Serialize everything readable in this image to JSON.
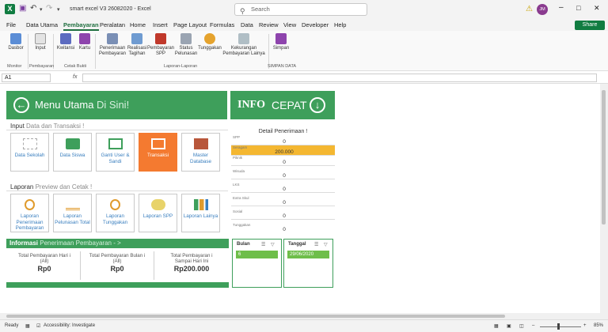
{
  "titlebar": {
    "title": "smart excel V3 26082020 - Excel",
    "search_placeholder": "Search",
    "avatar": "JM"
  },
  "menu": [
    "File",
    "Data Utama",
    "Pembayaran",
    "Peralatan",
    "Home",
    "Insert",
    "Page Layout",
    "Formulas",
    "Data",
    "Review",
    "View",
    "Developer",
    "Help"
  ],
  "share_label": "Share",
  "ribbon": {
    "buttons": [
      "Dasbor",
      "Input",
      "Kwitansi",
      "Kartu",
      "Penerimaan Pembayaran",
      "Realisasi Tagihan",
      "Pembayaran SPP",
      "Status Pelunasan",
      "Tunggakan",
      "Kekurangan Pembayaran Lainya",
      "Simpan"
    ],
    "groups": [
      "Monitor",
      "Pembayaran",
      "Cetak Bukti",
      "Laporan-Laporan",
      "SIMPAN DATA"
    ]
  },
  "formula": {
    "namebox": "A1",
    "fx": "fx"
  },
  "dashboard": {
    "menu_title_main": "Menu Utama",
    "menu_title_light": "Di Sini!",
    "input_head_main": "Input",
    "input_head_light": "Data dan Transaksi !",
    "input_tiles": [
      "Data Sekolah",
      "Data Siswa",
      "Ganti User & Sandi",
      "Transaksi",
      "Master Database"
    ],
    "laporan_head_main": "Laporan",
    "laporan_head_light": "Preview dan Cetak !",
    "laporan_tiles": [
      "Laporan Penerimaan Pembayaran",
      "Laporan Pelunasan Total",
      "Laporan Tunggakan",
      "Laporan SPP",
      "Laporan Lainya"
    ],
    "info_head_main": "Informasi",
    "info_head_light": "Penerimaan Pembayaran - >",
    "info_cells": [
      {
        "label": "Total Pembayaran Hari i",
        "sub": "(All)",
        "value": "Rp0"
      },
      {
        "label": "Total Pembayaran Bulan i",
        "sub": "(All)",
        "value": "Rp0"
      },
      {
        "label": "Total Pembayaran i",
        "sub": "Sampai Hari Ini",
        "value": "Rp200.000"
      }
    ]
  },
  "info_cepat": {
    "title_bold": "INFO",
    "title_light": "CEPAT",
    "detail_title": "Detail Penerimaan !",
    "rows": [
      {
        "label": "SPP",
        "value": "0"
      },
      {
        "label": "Seragam",
        "value": "200.000"
      },
      {
        "label": "Piknik",
        "value": "0"
      },
      {
        "label": "Wisuda",
        "value": "0"
      },
      {
        "label": "LKS",
        "value": "0"
      },
      {
        "label": "Extra Skul",
        "value": "0"
      },
      {
        "label": "Sosial",
        "value": "0"
      },
      {
        "label": "Tunggakan",
        "value": "0"
      }
    ],
    "slicer_bulan": {
      "header": "Bulan",
      "value": "6"
    },
    "slicer_tanggal": {
      "header": "Tanggal",
      "value": "29/06/2020"
    }
  },
  "status": {
    "ready": "Ready",
    "accessibility": "Accessibility: Investigate",
    "zoom": "85%"
  },
  "colors": {
    "green": "#3e9f5b",
    "orange": "#f47a30",
    "highlight": "#f4b731",
    "excel_green": "#107c41"
  }
}
